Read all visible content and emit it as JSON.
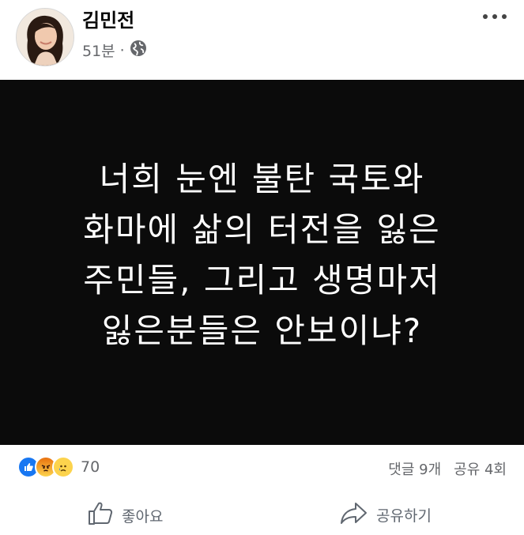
{
  "header": {
    "author": "김민전",
    "time": "51분",
    "separator": "·",
    "privacy_icon": "globe-icon",
    "more_icon": "more-options-icon"
  },
  "post": {
    "text": "너희 눈엔 불탄 국토와\n화마에 삶의 터전을 잃은\n주민들, 그리고 생명마저\n잃은분들은 안보이냐?"
  },
  "stats": {
    "reaction_icons": [
      "like-reaction-icon",
      "angry-reaction-icon",
      "sad-reaction-icon"
    ],
    "reaction_count": "70",
    "comments": "댓글 9개",
    "shares": "공유 4회"
  },
  "actions": {
    "like_label": "좋아요",
    "share_label": "공유하기"
  }
}
